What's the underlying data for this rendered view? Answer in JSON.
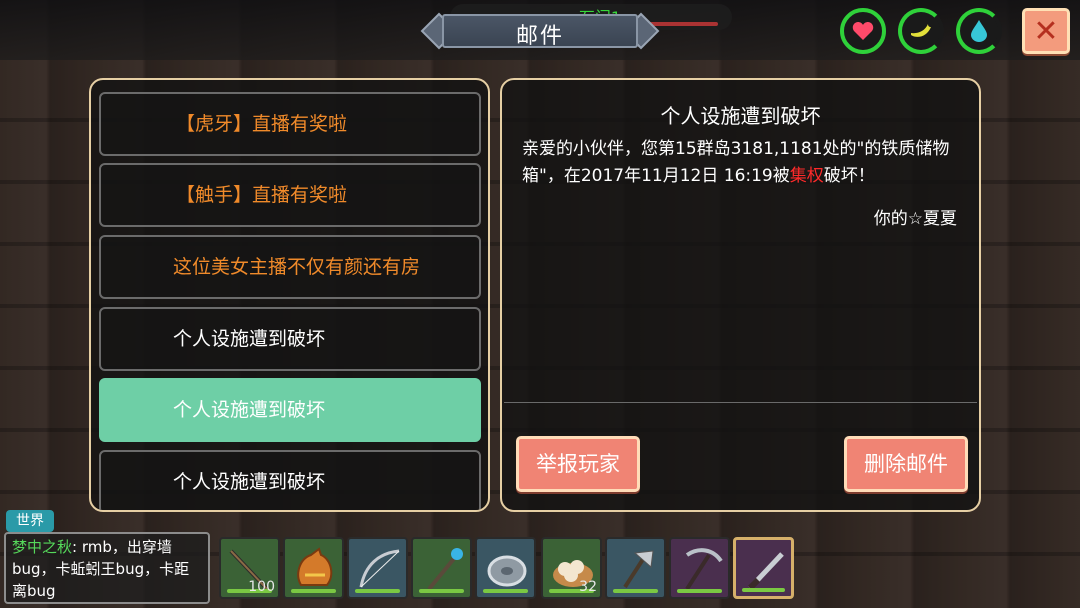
{
  "title": "邮件",
  "bg_player_name": "石门1",
  "stats": [
    {
      "name": "health",
      "icon": "heart-icon",
      "color": "#ff4a6a"
    },
    {
      "name": "hunger",
      "icon": "banana-icon",
      "color": "#e3e03a"
    },
    {
      "name": "thirst",
      "icon": "water-drop-icon",
      "color": "#37c7d7"
    }
  ],
  "close_label": "✕",
  "mail_list": [
    {
      "label": "【虎牙】直播有奖啦",
      "style": "orange",
      "selected": false
    },
    {
      "label": "【触手】直播有奖啦",
      "style": "orange",
      "selected": false
    },
    {
      "label": "这位美女主播不仅有颜还有房",
      "style": "orange",
      "selected": false
    },
    {
      "label": "个人设施遭到破坏",
      "style": "white",
      "selected": false
    },
    {
      "label": "个人设施遭到破坏",
      "style": "white",
      "selected": true
    },
    {
      "label": "个人设施遭到破坏",
      "style": "white",
      "selected": false
    }
  ],
  "detail": {
    "title": "个人设施遭到破坏",
    "body_before": "亲爱的小伙伴，您第15群岛3181,1181处的\"的铁质储物箱\"，在2017年11月12日 16:19被",
    "body_highlight": "集权",
    "body_after": "破坏！",
    "signature": "你的☆夏夏",
    "report_button": "举报玩家",
    "delete_button": "删除邮件"
  },
  "chat": {
    "tab": "世界",
    "sender": "梦中之秋",
    "message": ": rmb，出穿墙bug，卡蚯蚓王bug，卡距离bug"
  },
  "hotbar": [
    {
      "item": "fishing-rod-icon",
      "count": "100",
      "color": "green"
    },
    {
      "item": "pouch-icon",
      "count": "",
      "color": "green"
    },
    {
      "item": "bow-icon",
      "count": "",
      "color": "blue"
    },
    {
      "item": "staff-icon",
      "count": "",
      "color": "green"
    },
    {
      "item": "shield-icon",
      "count": "",
      "color": "blue"
    },
    {
      "item": "bun-icon",
      "count": "32",
      "color": "green"
    },
    {
      "item": "axe-icon",
      "count": "",
      "color": "blue"
    },
    {
      "item": "pickaxe-icon",
      "count": "",
      "color": "purple"
    },
    {
      "item": "sword-icon",
      "count": "",
      "color": "purple",
      "selected": true
    }
  ]
}
